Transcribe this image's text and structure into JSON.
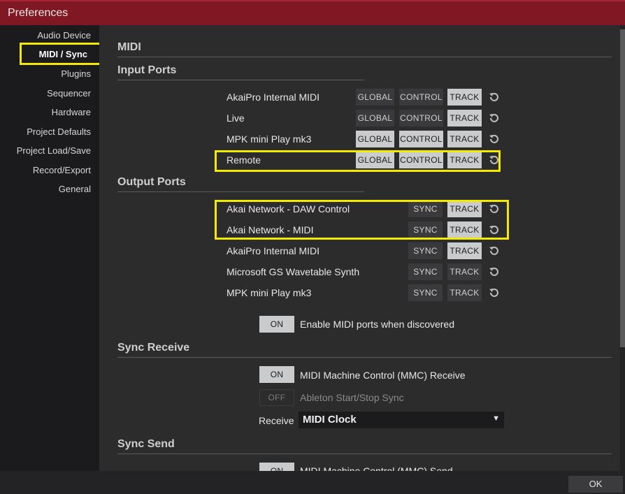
{
  "window": {
    "title": "Preferences"
  },
  "sidebar": {
    "items": [
      {
        "label": "Audio Device"
      },
      {
        "label": "MIDI / Sync"
      },
      {
        "label": "Plugins"
      },
      {
        "label": "Sequencer"
      },
      {
        "label": "Hardware"
      },
      {
        "label": "Project Defaults"
      },
      {
        "label": "Project Load/Save"
      },
      {
        "label": "Record/Export"
      },
      {
        "label": "General"
      }
    ],
    "active": "MIDI / Sync"
  },
  "main": {
    "heading": "MIDI",
    "input_ports": {
      "title": "Input Ports",
      "buttons": {
        "global": "GLOBAL",
        "control": "CONTROL",
        "track": "TRACK"
      },
      "rows": [
        {
          "name": "AkaiPro Internal MIDI",
          "global": false,
          "control": false,
          "track": true
        },
        {
          "name": "Live",
          "global": false,
          "control": false,
          "track": true
        },
        {
          "name": "MPK mini Play mk3",
          "global": true,
          "control": true,
          "track": true
        },
        {
          "name": "Remote",
          "global": true,
          "control": true,
          "track": true
        }
      ]
    },
    "output_ports": {
      "title": "Output Ports",
      "buttons": {
        "sync": "SYNC",
        "track": "TRACK"
      },
      "rows": [
        {
          "name": "Akai Network - DAW Control",
          "sync": false,
          "track": true
        },
        {
          "name": "Akai Network - MIDI",
          "sync": false,
          "track": true
        },
        {
          "name": "AkaiPro Internal MIDI",
          "sync": false,
          "track": true
        },
        {
          "name": "Microsoft GS Wavetable Synth",
          "sync": false,
          "track": false
        },
        {
          "name": "MPK mini Play mk3",
          "sync": false,
          "track": false
        }
      ]
    },
    "enable_ports": {
      "toggle": "ON",
      "label": "Enable MIDI ports when discovered"
    },
    "sync_receive": {
      "title": "Sync Receive",
      "mmc_receive": {
        "toggle": "ON",
        "label": "MIDI Machine Control (MMC) Receive"
      },
      "ableton": {
        "toggle": "OFF",
        "label": "Ableton Start/Stop Sync"
      },
      "receive": {
        "label": "Receive",
        "value": "MIDI Clock"
      }
    },
    "sync_send": {
      "title": "Sync Send",
      "mmc_send": {
        "toggle": "ON",
        "label": "MIDI Machine Control (MMC) Send"
      }
    }
  },
  "footer": {
    "ok_label": "OK"
  },
  "colors": {
    "titlebar": "#7f1823",
    "highlight": "#f2ea00",
    "button_on": "#c9cbcd",
    "button_off": "#3a3a3c"
  }
}
